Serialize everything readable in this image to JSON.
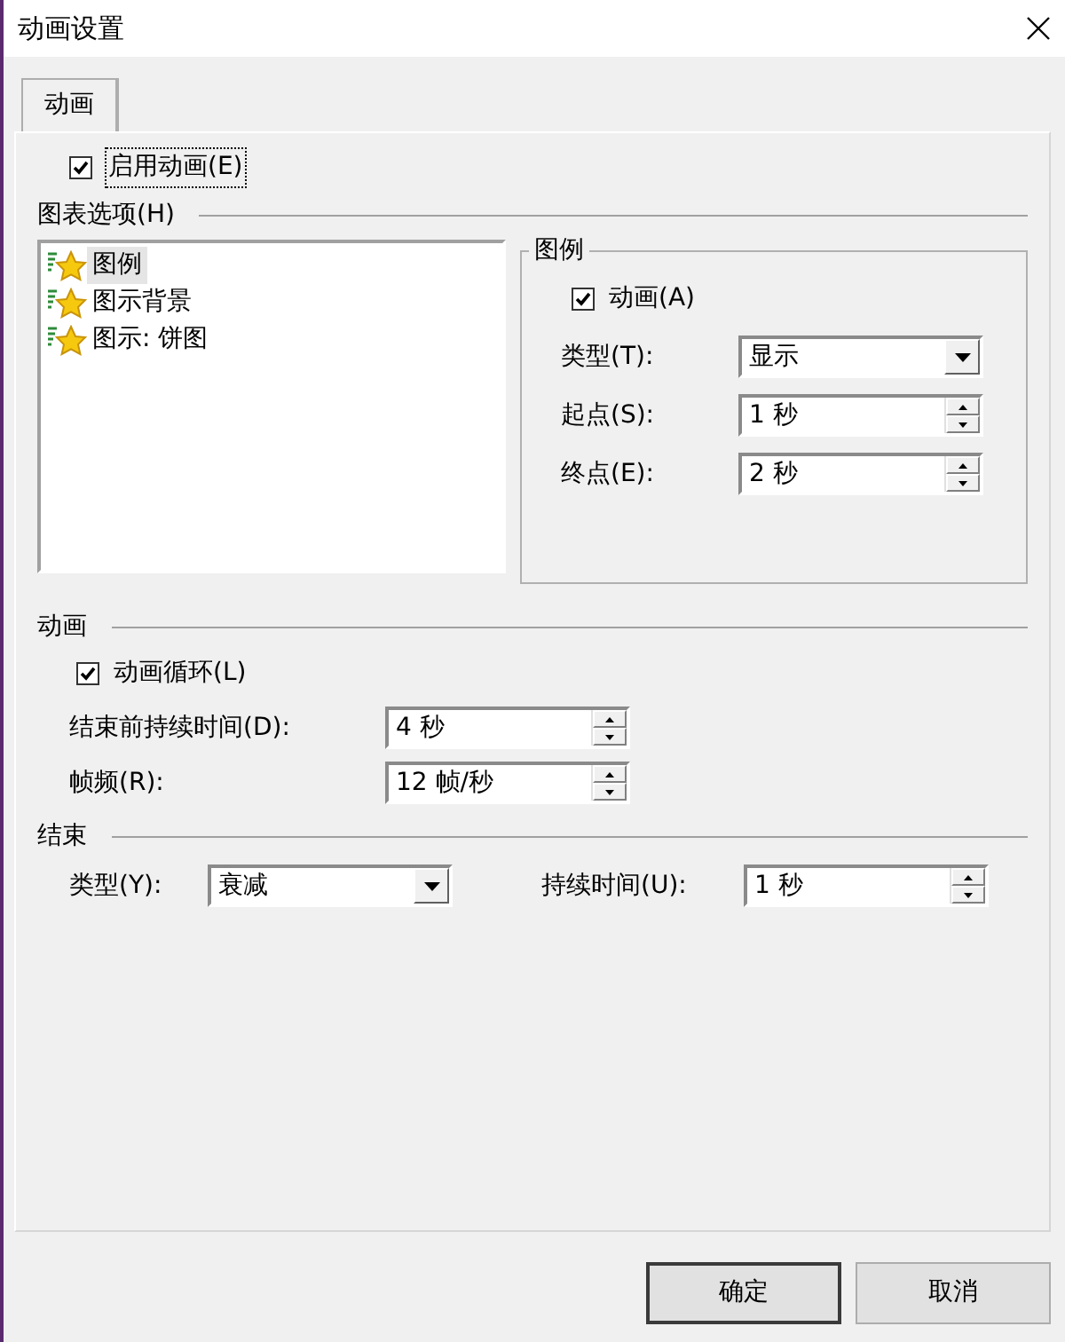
{
  "window": {
    "title": "动画设置"
  },
  "tabs": [
    {
      "label": "动画",
      "selected": true
    }
  ],
  "enable_animation": {
    "label": "启用动画(E)",
    "checked": true,
    "focused": true
  },
  "chart_options": {
    "heading": "图表选项(H)",
    "items": [
      {
        "label": "图例",
        "selected": true
      },
      {
        "label": "图示背景",
        "selected": false
      },
      {
        "label": "图示: 饼图",
        "selected": false
      }
    ]
  },
  "legend_group": {
    "title": "图例",
    "animate": {
      "label": "动画(A)",
      "checked": true
    },
    "fields": [
      {
        "kind": "combo",
        "label": "类型(T):",
        "value": "显示"
      },
      {
        "kind": "spin",
        "label": "起点(S):",
        "value": "1 秒"
      },
      {
        "kind": "spin",
        "label": "终点(E):",
        "value": "2 秒"
      }
    ]
  },
  "animation": {
    "heading": "动画",
    "loop": {
      "label": "动画循环(L)",
      "checked": true
    },
    "fields": [
      {
        "kind": "spin",
        "label": "结束前持续时间(D):",
        "value": "4 秒"
      },
      {
        "kind": "spin",
        "label": "帧频(R):",
        "value": "12 帧/秒"
      }
    ]
  },
  "end": {
    "heading": "结束",
    "fields": [
      {
        "kind": "combo",
        "label": "类型(Y):",
        "value": "衰减"
      },
      {
        "kind": "spin",
        "label": "持续时间(U):",
        "value": "1 秒"
      }
    ]
  },
  "buttons": [
    {
      "label": "确定",
      "default": true
    },
    {
      "label": "取消",
      "default": false
    }
  ]
}
